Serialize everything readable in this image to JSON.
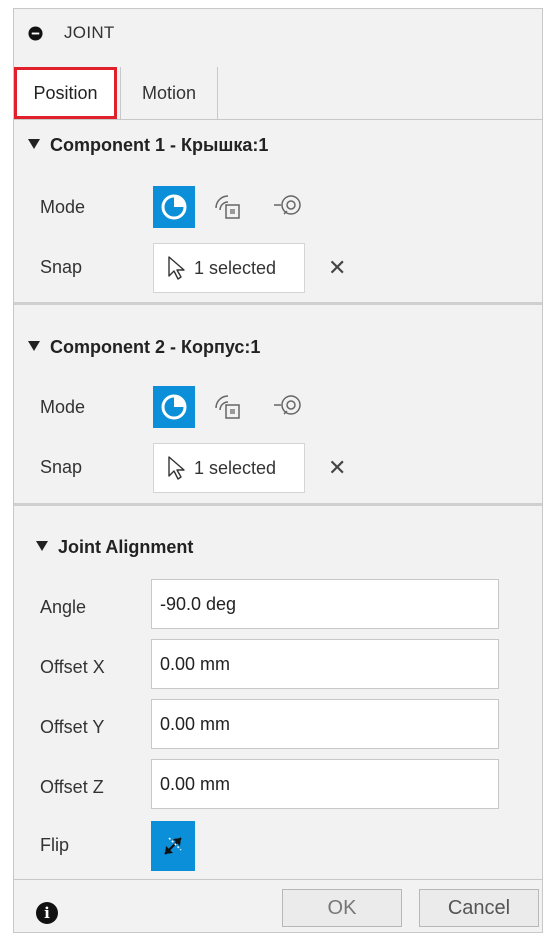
{
  "header": {
    "title": "JOINT"
  },
  "tabs": [
    {
      "label": "Position",
      "active": true
    },
    {
      "label": "Motion",
      "active": false
    }
  ],
  "component1": {
    "title": "Component 1 - Крышка:1",
    "mode_label": "Mode",
    "snap_label": "Snap",
    "snap_value": "1 selected"
  },
  "component2": {
    "title": "Component 2 - Корпус:1",
    "mode_label": "Mode",
    "snap_label": "Snap",
    "snap_value": "1 selected"
  },
  "alignment": {
    "title": "Joint Alignment",
    "angle_label": "Angle",
    "angle_value": "-90.0 deg",
    "offset_x_label": "Offset X",
    "offset_x_value": "0.00 mm",
    "offset_y_label": "Offset Y",
    "offset_y_value": "0.00 mm",
    "offset_z_label": "Offset Z",
    "offset_z_value": "0.00 mm",
    "flip_label": "Flip"
  },
  "footer": {
    "ok_label": "OK",
    "cancel_label": "Cancel"
  },
  "colors": {
    "accent": "#0a8fd8",
    "highlight": "#e0202a",
    "panel_bg": "#f2f2f2"
  },
  "icons": [
    "minus-circle-icon",
    "snap-mode-icon",
    "between-mode-icon",
    "tangent-mode-icon",
    "cursor-arrow-icon",
    "close-icon",
    "flip-icon",
    "info-icon"
  ]
}
